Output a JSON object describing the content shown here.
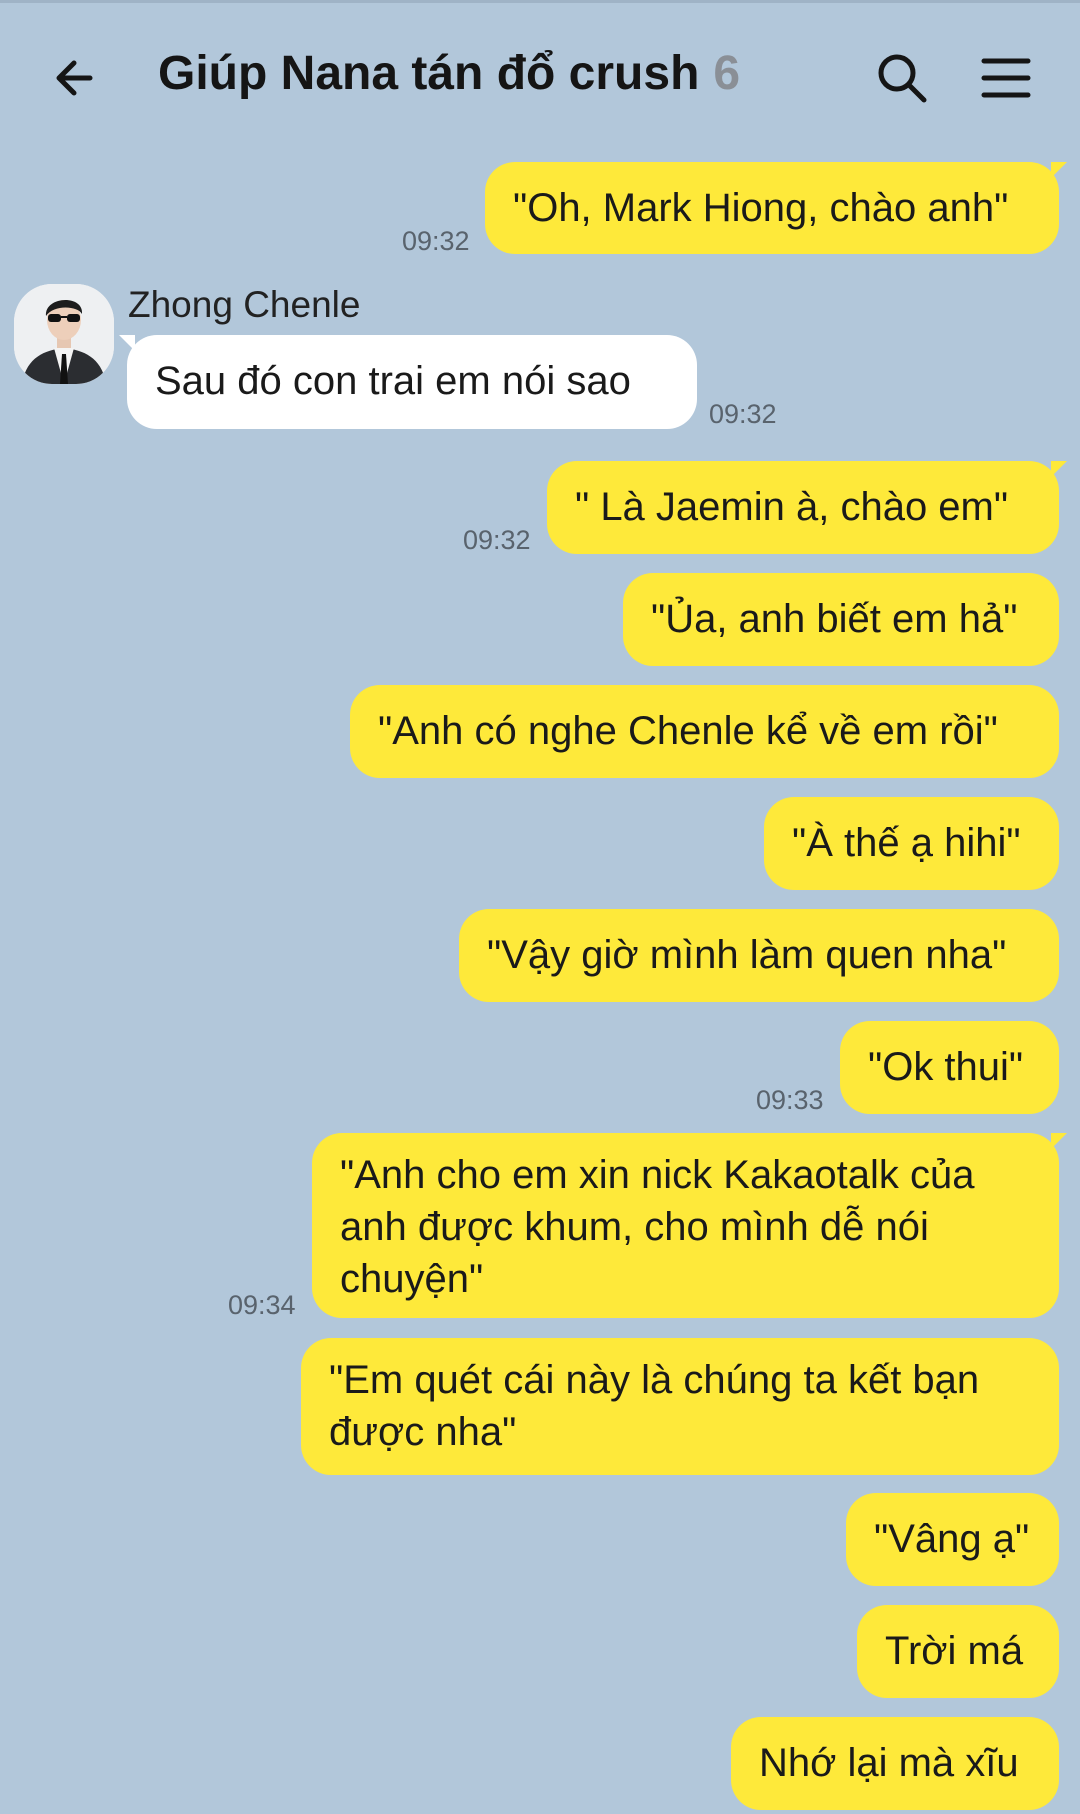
{
  "header": {
    "title": "Giúp Nana tán đổ crush",
    "member_count": "6",
    "back_icon": "arrow-left-icon",
    "search_icon": "search-icon",
    "menu_icon": "hamburger-menu-icon"
  },
  "colors": {
    "background": "#b2c7da",
    "outgoing_bubble": "#fee93a",
    "incoming_bubble": "#ffffff"
  },
  "incoming": {
    "sender": "Zhong Chenle",
    "text": "Sau đó con trai em nói sao",
    "time": "09:32"
  },
  "messages": [
    {
      "text": "\"Oh, Mark Hiong, chào anh\"",
      "time": "09:32"
    },
    {
      "text": "\" Là Jaemin à, chào em\"",
      "time": "09:32"
    },
    {
      "text": "\"Ủa, anh biết em hả\"",
      "time": ""
    },
    {
      "text": "\"Anh có nghe Chenle kể về em rồi\"",
      "time": ""
    },
    {
      "text": "\"À thế ạ hihi\"",
      "time": ""
    },
    {
      "text": "\"Vậy giờ mình làm quen nha\"",
      "time": ""
    },
    {
      "text": "\"Ok thui\"",
      "time": "09:33"
    },
    {
      "text": "\"Anh cho em xin nick Kakaotalk của anh được khum, cho mình dễ nói chuyện\"",
      "time": "09:34"
    },
    {
      "text": "\"Em quét cái này là chúng ta kết bạn được nha\"",
      "time": ""
    },
    {
      "text": "\"Vâng ạ\"",
      "time": ""
    },
    {
      "text": "Trời má",
      "time": ""
    },
    {
      "text": "Nhớ lại mà xĩu",
      "time": ""
    }
  ]
}
